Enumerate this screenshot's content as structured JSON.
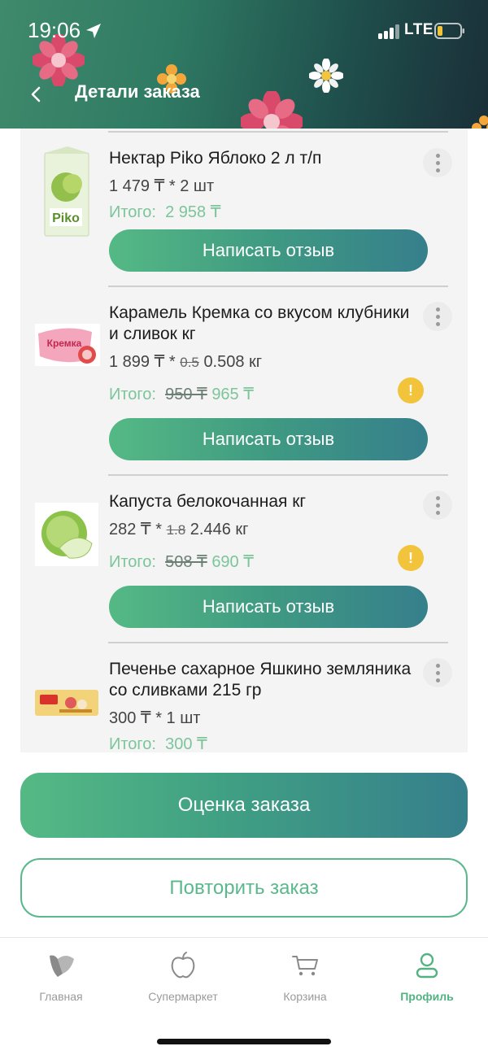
{
  "status": {
    "time": "19:06",
    "network": "LTE"
  },
  "header": {
    "title": "Детали заказа"
  },
  "items": [
    {
      "name": "Нектар Piko Яблоко 2 л т/п",
      "qty": "1 479 ₸ * 2 шт",
      "total_label": "Итого:",
      "total": "2 958 ₸",
      "review": "Написать отзыв"
    },
    {
      "name": "Карамель Кремка со вкусом клубники и сливок кг",
      "price": "1 899 ₸ *",
      "old_qty": "0.5",
      "new_qty": "0.508 кг",
      "total_label": "Итого:",
      "old_total": "950 ₸",
      "total": "965 ₸",
      "review": "Написать отзыв",
      "warning": "!"
    },
    {
      "name": "Капуста белокочанная кг",
      "price": "282 ₸ *",
      "old_qty": "1.8",
      "new_qty": "2.446 кг",
      "total_label": "Итого:",
      "old_total": "508 ₸",
      "total": "690 ₸",
      "review": "Написать отзыв",
      "warning": "!"
    },
    {
      "name": "Печенье сахарное Яшкино земляника со сливками 215 гр",
      "qty": "300 ₸ * 1 шт",
      "total_label": "Итого:",
      "total": "300 ₸"
    }
  ],
  "actions": {
    "rate": "Оценка заказа",
    "repeat": "Повторить заказ"
  },
  "tabs": [
    {
      "label": "Главная",
      "icon": "home-leaf-icon"
    },
    {
      "label": "Супермаркет",
      "icon": "apple-icon"
    },
    {
      "label": "Корзина",
      "icon": "cart-icon"
    },
    {
      "label": "Профиль",
      "icon": "profile-icon",
      "active": true
    }
  ],
  "colors": {
    "accent": "#53b282",
    "header_dark": "#1a2f38",
    "warning": "#f2c43b"
  }
}
